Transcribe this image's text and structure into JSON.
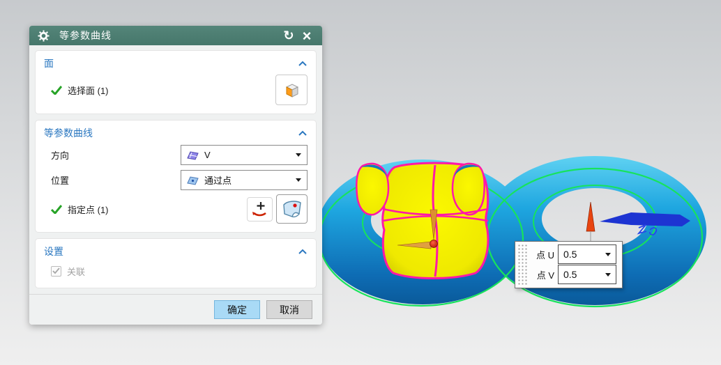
{
  "dialog": {
    "title": "等参数曲线",
    "reset_glyph": "↻",
    "close_glyph": "×",
    "sections": {
      "face": {
        "header": "面",
        "select_face_label": "选择面 (1)"
      },
      "isocurve": {
        "header": "等参数曲线",
        "direction_label": "方向",
        "direction_value": "V",
        "position_label": "位置",
        "position_value": "通过点",
        "specify_point_label": "指定点 (1)"
      },
      "settings": {
        "header": "设置",
        "associative_label": "关联",
        "associative_checked": true
      }
    },
    "footer": {
      "ok_label": "确定",
      "cancel_label": "取消"
    }
  },
  "uv_panel": {
    "u_label": "点 U",
    "u_value": "0.5",
    "v_label": "点 V",
    "v_value": "0.5"
  },
  "colors": {
    "titlebar_teal": "#4b7d71",
    "accent_blue": "#2a77c0",
    "ok_button_fill": "#a9daf6",
    "model_blue": "#1b9ad6",
    "selected_face_yellow": "#f2ee00",
    "edge_magenta": "#ff18a8",
    "iso_curve_green": "#17e35c",
    "check_green": "#27a327"
  }
}
